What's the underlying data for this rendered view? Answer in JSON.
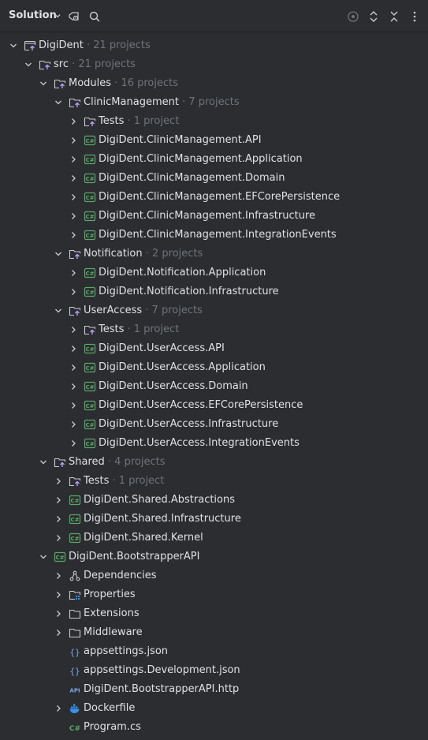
{
  "header": {
    "title": "Solution",
    "icons": [
      "chevron-down-icon",
      "solution-filter-icon",
      "search-icon",
      "locate-icon",
      "expand-collapse-icon",
      "collapse-all-icon",
      "more-options-icon"
    ]
  },
  "tree": [
    {
      "level": 0,
      "expanded": true,
      "icon": "solution",
      "label": "DigiDent",
      "count": " · 21 projects"
    },
    {
      "level": 1,
      "expanded": true,
      "icon": "solution-folder",
      "label": "src",
      "count": " · 21 projects"
    },
    {
      "level": 2,
      "expanded": true,
      "icon": "solution-folder",
      "label": "Modules",
      "count": " · 16 projects"
    },
    {
      "level": 3,
      "expanded": true,
      "icon": "solution-folder",
      "label": "ClinicManagement",
      "count": " · 7 projects"
    },
    {
      "level": 4,
      "expanded": false,
      "icon": "solution-folder",
      "label": "Tests",
      "count": " · 1 project"
    },
    {
      "level": 4,
      "expanded": false,
      "icon": "csharp-project",
      "label": "DigiDent.ClinicManagement.API",
      "count": ""
    },
    {
      "level": 4,
      "expanded": false,
      "icon": "csharp-project",
      "label": "DigiDent.ClinicManagement.Application",
      "count": ""
    },
    {
      "level": 4,
      "expanded": false,
      "icon": "csharp-project",
      "label": "DigiDent.ClinicManagement.Domain",
      "count": ""
    },
    {
      "level": 4,
      "expanded": false,
      "icon": "csharp-project",
      "label": "DigiDent.ClinicManagement.EFCorePersistence",
      "count": ""
    },
    {
      "level": 4,
      "expanded": false,
      "icon": "csharp-project",
      "label": "DigiDent.ClinicManagement.Infrastructure",
      "count": ""
    },
    {
      "level": 4,
      "expanded": false,
      "icon": "csharp-project",
      "label": "DigiDent.ClinicManagement.IntegrationEvents",
      "count": ""
    },
    {
      "level": 3,
      "expanded": true,
      "icon": "solution-folder",
      "label": "Notification",
      "count": " · 2 projects"
    },
    {
      "level": 4,
      "expanded": false,
      "icon": "csharp-project",
      "label": "DigiDent.Notification.Application",
      "count": ""
    },
    {
      "level": 4,
      "expanded": false,
      "icon": "csharp-project",
      "label": "DigiDent.Notification.Infrastructure",
      "count": ""
    },
    {
      "level": 3,
      "expanded": true,
      "icon": "solution-folder",
      "label": "UserAccess",
      "count": " · 7 projects"
    },
    {
      "level": 4,
      "expanded": false,
      "icon": "solution-folder",
      "label": "Tests",
      "count": " · 1 project"
    },
    {
      "level": 4,
      "expanded": false,
      "icon": "csharp-project",
      "label": "DigiDent.UserAccess.API",
      "count": ""
    },
    {
      "level": 4,
      "expanded": false,
      "icon": "csharp-project",
      "label": "DigiDent.UserAccess.Application",
      "count": ""
    },
    {
      "level": 4,
      "expanded": false,
      "icon": "csharp-project",
      "label": "DigiDent.UserAccess.Domain",
      "count": ""
    },
    {
      "level": 4,
      "expanded": false,
      "icon": "csharp-project",
      "label": "DigiDent.UserAccess.EFCorePersistence",
      "count": ""
    },
    {
      "level": 4,
      "expanded": false,
      "icon": "csharp-project",
      "label": "DigiDent.UserAccess.Infrastructure",
      "count": ""
    },
    {
      "level": 4,
      "expanded": false,
      "icon": "csharp-project",
      "label": "DigiDent.UserAccess.IntegrationEvents",
      "count": ""
    },
    {
      "level": 2,
      "expanded": true,
      "icon": "solution-folder",
      "label": "Shared",
      "count": " · 4 projects"
    },
    {
      "level": 3,
      "expanded": false,
      "icon": "solution-folder",
      "label": "Tests",
      "count": " · 1 project"
    },
    {
      "level": 3,
      "expanded": false,
      "icon": "csharp-project",
      "label": "DigiDent.Shared.Abstractions",
      "count": ""
    },
    {
      "level": 3,
      "expanded": false,
      "icon": "csharp-project",
      "label": "DigiDent.Shared.Infrastructure",
      "count": ""
    },
    {
      "level": 3,
      "expanded": false,
      "icon": "csharp-project",
      "label": "DigiDent.Shared.Kernel",
      "count": ""
    },
    {
      "level": 2,
      "expanded": true,
      "icon": "csharp-project",
      "label": "DigiDent.BootstrapperAPI",
      "count": ""
    },
    {
      "level": 3,
      "expanded": false,
      "icon": "dependencies",
      "label": "Dependencies",
      "count": ""
    },
    {
      "level": 3,
      "expanded": false,
      "icon": "properties-folder",
      "label": "Properties",
      "count": ""
    },
    {
      "level": 3,
      "expanded": false,
      "icon": "folder",
      "label": "Extensions",
      "count": ""
    },
    {
      "level": 3,
      "expanded": false,
      "icon": "folder",
      "label": "Middleware",
      "count": ""
    },
    {
      "level": 3,
      "expanded": null,
      "icon": "json-file",
      "label": "appsettings.json",
      "count": ""
    },
    {
      "level": 3,
      "expanded": null,
      "icon": "json-file",
      "label": "appsettings.Development.json",
      "count": ""
    },
    {
      "level": 3,
      "expanded": null,
      "icon": "http-file",
      "label": "DigiDent.BootstrapperAPI.http",
      "count": ""
    },
    {
      "level": 3,
      "expanded": false,
      "icon": "docker",
      "label": "Dockerfile",
      "count": ""
    },
    {
      "level": 3,
      "expanded": null,
      "icon": "csharp-file",
      "label": "Program.cs",
      "count": ""
    }
  ],
  "colors": {
    "background": "#2b2d30",
    "text": "#dfe1e5",
    "count_text": "#6f737a",
    "csharp_green": "#59a869",
    "solution_purple": "#b99bf8",
    "docker_blue": "#3592f2",
    "json_blue": "#7aa6e8"
  }
}
